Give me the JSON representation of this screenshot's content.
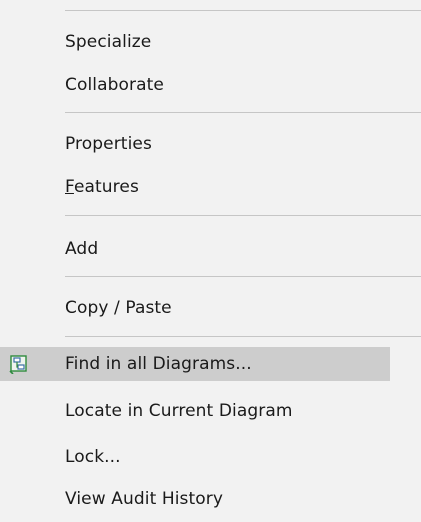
{
  "menu": {
    "items": [
      {
        "label": "Specialize"
      },
      {
        "label": "Collaborate"
      },
      {
        "label": "Properties"
      },
      {
        "label_accel": "F",
        "label_rest": "eatures"
      },
      {
        "label": "Add"
      },
      {
        "label": "Copy / Paste"
      },
      {
        "label": "Find in all Diagrams...",
        "icon": "diagram-tree-icon",
        "highlighted": true
      },
      {
        "label": "Locate in Current Diagram"
      },
      {
        "label": "Lock..."
      },
      {
        "label": "View Audit History"
      }
    ]
  },
  "colors": {
    "background": "#f2f2f2",
    "highlight": "#cdcdcd",
    "separator": "#c6c6c6",
    "icon_green": "#2e8b3e",
    "icon_blue": "#3a6ea5"
  }
}
